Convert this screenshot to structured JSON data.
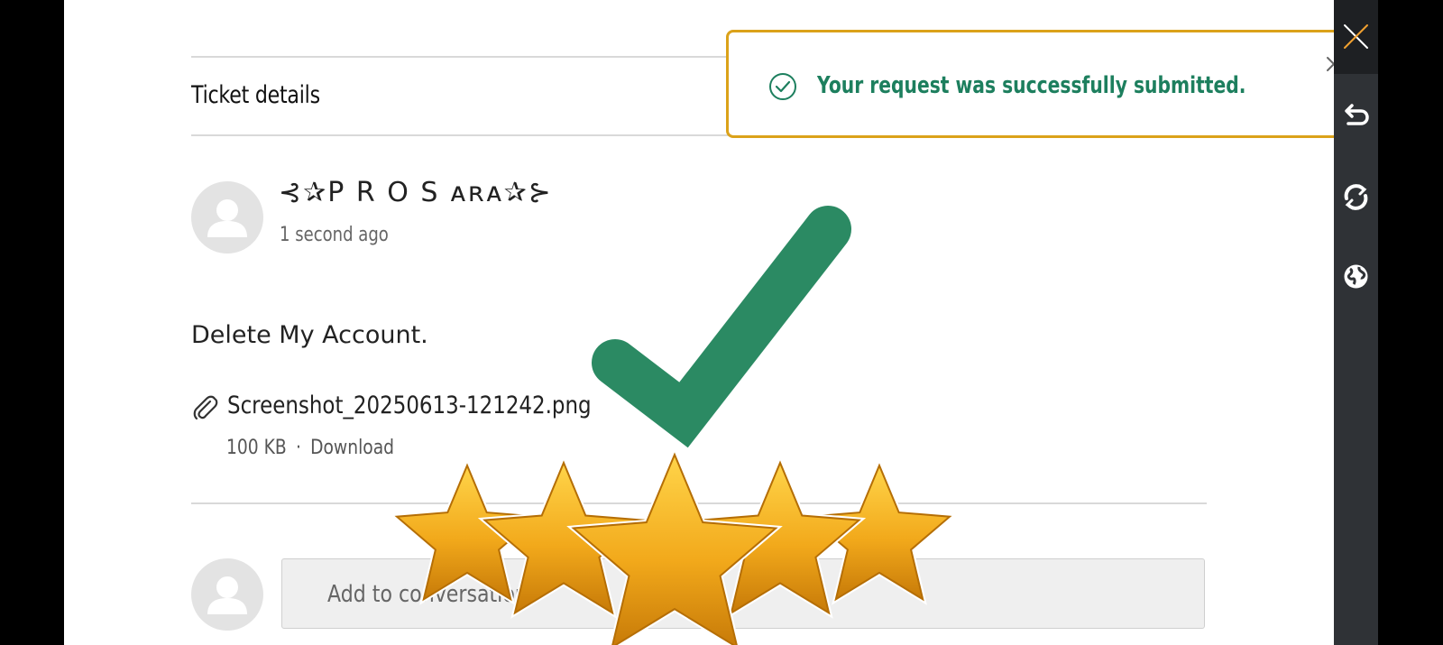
{
  "ticket": {
    "section_title": "Ticket details",
    "author_name": "⊰✰P R O S ᴀʀᴀ✰⊱",
    "timestamp": "1 second ago",
    "message": "Delete My Account.",
    "attachment": {
      "file_name": "Screenshot_20250613-121242.png",
      "file_size": "100 KB",
      "separator": "·",
      "download_label": "Download"
    }
  },
  "reply": {
    "placeholder": "Add to conversation"
  },
  "toast": {
    "message": "Your request was successfully submitted.",
    "check_icon": "check-circle-icon",
    "close_icon": "close-icon"
  },
  "overlay": {
    "check_icon": "big-checkmark-icon",
    "rating_stars": 5
  },
  "sidebar": {
    "buttons": [
      "close-icon",
      "undo-icon",
      "refresh-icon",
      "globe-icon"
    ]
  },
  "colors": {
    "toast_border": "#dba21a",
    "success_green": "#1d7f5e",
    "overlay_check_green": "#2b8a63",
    "star_gold": "#f2a91b",
    "sidebar_bg": "#2f3236"
  }
}
